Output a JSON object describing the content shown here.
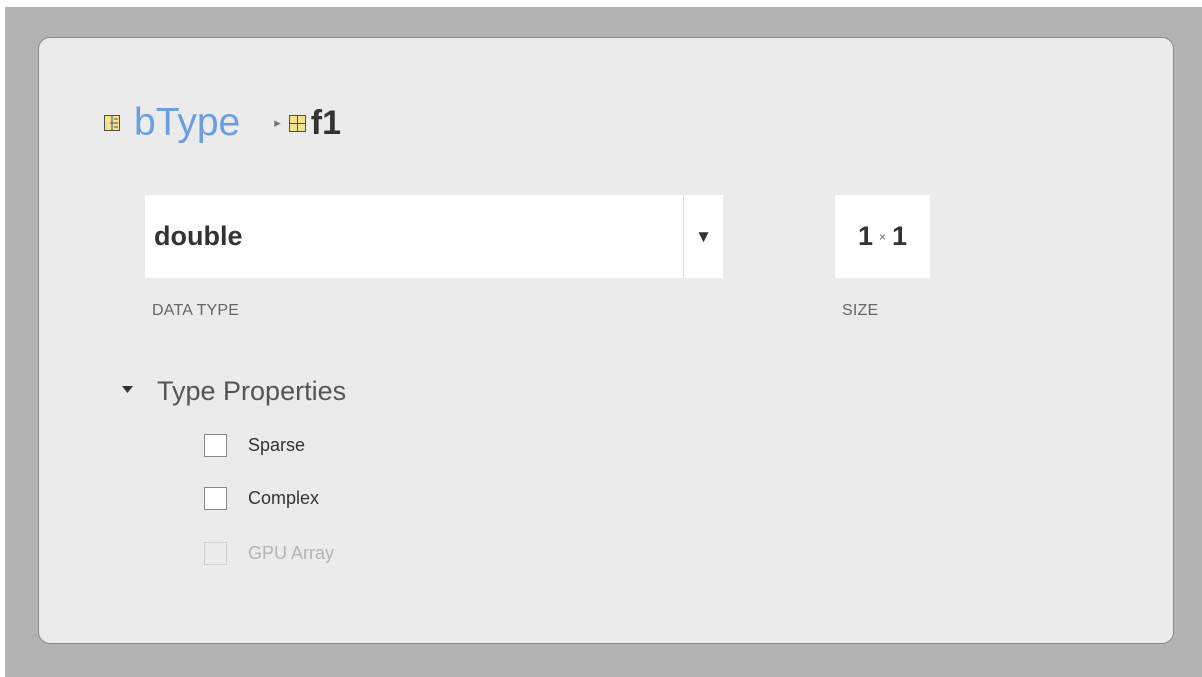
{
  "breadcrumb": {
    "parent_label": "bType",
    "parent_icon": "struct-icon",
    "separator": "▸",
    "current_label": "f1",
    "current_icon": "field-grid-icon"
  },
  "data_type": {
    "value": "double",
    "label": "DATA TYPE",
    "dropdown_icon": "▼"
  },
  "size": {
    "rows": "1",
    "separator": "×",
    "cols": "1",
    "label": "SIZE"
  },
  "type_properties": {
    "title": "Type Properties",
    "collapse_icon": "▾",
    "options": [
      {
        "label": "Sparse",
        "checked": false,
        "enabled": true
      },
      {
        "label": "Complex",
        "checked": false,
        "enabled": true
      },
      {
        "label": "GPU Array",
        "checked": false,
        "enabled": false
      }
    ]
  },
  "colors": {
    "link": "#6a9ee0",
    "panel_background": "#ebebeb",
    "outer_background": "#b3b3b3",
    "icon_yellow": "#f3e28e"
  }
}
